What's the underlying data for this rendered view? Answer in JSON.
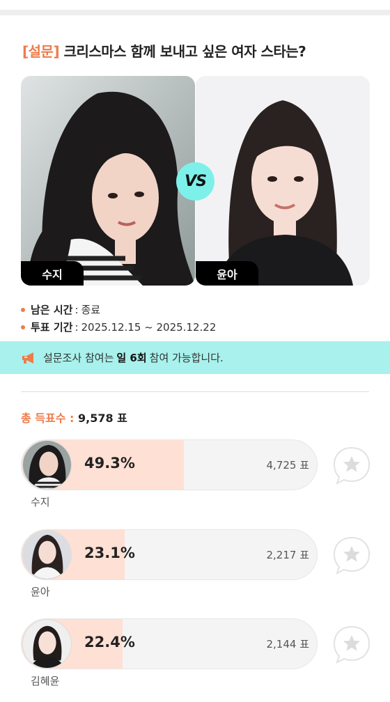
{
  "poll": {
    "tag": "[설문]",
    "question": "크리스마스 함께 보내고 싶은 여자 스타는?"
  },
  "vs_label": "VS",
  "contestants": {
    "left": {
      "name": "수지"
    },
    "right": {
      "name": "윤아"
    }
  },
  "info": {
    "remaining_label": "남은 시간",
    "remaining_value": "종료",
    "period_label": "투표 기간",
    "period_value": "2025.12.15 ~ 2025.12.22"
  },
  "notice": {
    "prefix": "설문조사 참여는",
    "highlight": "일 6회",
    "suffix": "참여 가능합니다."
  },
  "total": {
    "label": "총 득표수",
    "value": "9,578 표"
  },
  "results": [
    {
      "name": "수지",
      "percent": "49.3%",
      "votes": "4,725 표",
      "share": 0.493
    },
    {
      "name": "윤아",
      "percent": "23.1%",
      "votes": "2,217 표",
      "share": 0.231
    },
    {
      "name": "김혜윤",
      "percent": "22.4%",
      "votes": "2,144 표",
      "share": 0.224
    }
  ],
  "colors": {
    "accent": "#ef7b4a",
    "notice_bg": "#a8f1ec",
    "vs_bg": "#7ef0ea",
    "bar_fill": "#ffe0d4"
  },
  "icons": {
    "notice": "megaphone-icon",
    "vote": "star-chat-icon"
  }
}
